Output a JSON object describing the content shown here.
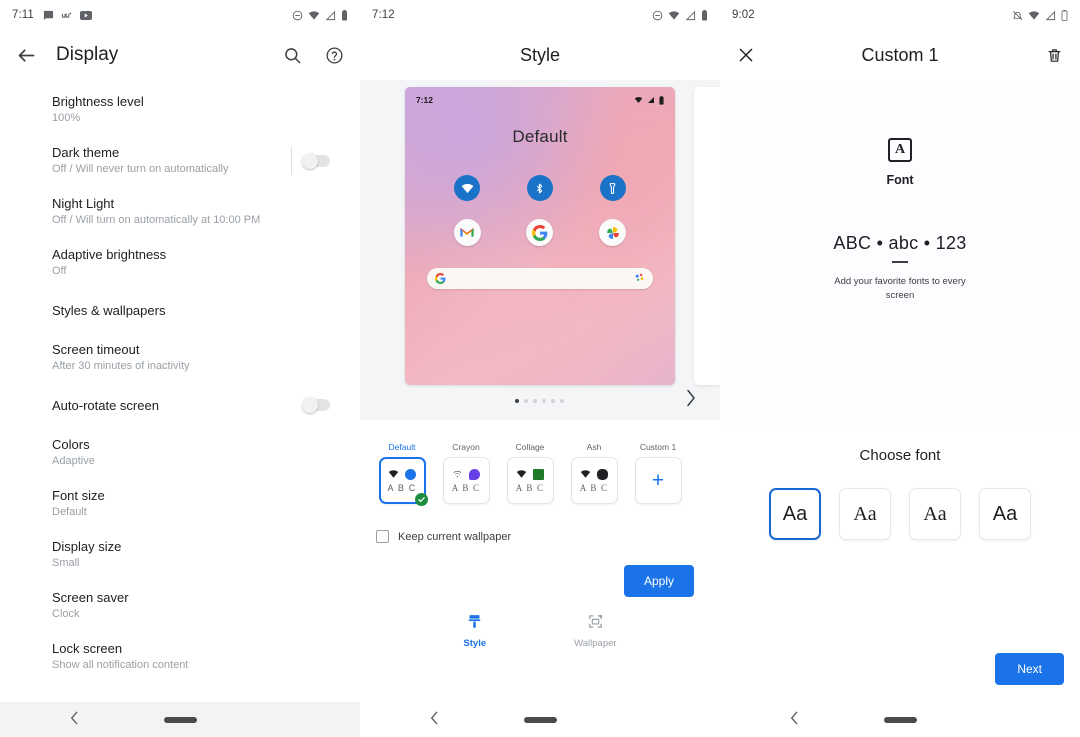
{
  "panels": {
    "display": {
      "status": {
        "time": "7:11",
        "left_icons": [
          "chat-icon",
          "wave-icon",
          "youtube-icon"
        ],
        "right_icons": [
          "dnd-icon",
          "wifi-icon",
          "signal-icon",
          "battery-icon"
        ]
      },
      "appbar": {
        "back": "back-arrow-icon",
        "title": "Display",
        "search": "search-icon",
        "help": "help-icon"
      },
      "items": [
        {
          "title": "Brightness level",
          "subtitle": "100%",
          "toggle": null
        },
        {
          "title": "Dark theme",
          "subtitle": "Off / Will never turn on automatically",
          "toggle": "off"
        },
        {
          "title": "Night Light",
          "subtitle": "Off / Will turn on automatically at 10:00 PM",
          "toggle": null
        },
        {
          "title": "Adaptive brightness",
          "subtitle": "Off",
          "toggle": null
        },
        {
          "title": "Styles & wallpapers",
          "subtitle": "",
          "toggle": null
        },
        {
          "title": "Screen timeout",
          "subtitle": "After 30 minutes of inactivity",
          "toggle": null
        },
        {
          "title": "Auto-rotate screen",
          "subtitle": "",
          "toggle": "off"
        },
        {
          "title": "Colors",
          "subtitle": "Adaptive",
          "toggle": null
        },
        {
          "title": "Font size",
          "subtitle": "Default",
          "toggle": null
        },
        {
          "title": "Display size",
          "subtitle": "Small",
          "toggle": null
        },
        {
          "title": "Screen saver",
          "subtitle": "Clock",
          "toggle": null
        },
        {
          "title": "Lock screen",
          "subtitle": "Show all notification content",
          "toggle": null
        }
      ]
    },
    "style": {
      "status": {
        "time": "7:12",
        "right_icons": [
          "dnd-icon",
          "wifi-icon",
          "signal-icon",
          "battery-icon"
        ]
      },
      "appbar": {
        "title": "Style"
      },
      "preview": {
        "clock": "7:12",
        "label": "Default",
        "quick_tiles": [
          "wifi-icon",
          "bluetooth-icon",
          "flashlight-icon"
        ],
        "apps": [
          "gmail-icon",
          "google-icon",
          "photos-icon"
        ],
        "search_left": "google-g-icon",
        "search_right": "assistant-mic-icon",
        "pages": 6,
        "active_page": 1,
        "next": "chevron-right-icon"
      },
      "thumbs": [
        {
          "label": "Default",
          "abc": "A B C",
          "serif": false,
          "selected": true,
          "shape": "circle",
          "color": "#1a73e8",
          "wifi": "solid"
        },
        {
          "label": "Crayon",
          "abc": "A B C",
          "serif": true,
          "selected": false,
          "shape": "blob",
          "color": "#6b3fe8",
          "wifi": "thin"
        },
        {
          "label": "Collage",
          "abc": "A B C",
          "serif": true,
          "selected": false,
          "shape": "square",
          "color": "#1e7a28",
          "wifi": "solid"
        },
        {
          "label": "Ash",
          "abc": "A B C",
          "serif": true,
          "selected": false,
          "shape": "squircle",
          "color": "#202124",
          "wifi": "solid"
        },
        {
          "label": "Custom 1",
          "abc": "",
          "serif": false,
          "selected": false,
          "shape": "plus",
          "color": "#1a73e8",
          "wifi": ""
        }
      ],
      "keep_wallpaper_label": "Keep current wallpaper",
      "keep_wallpaper_checked": false,
      "apply_label": "Apply",
      "tabs": [
        {
          "label": "Style",
          "icon": "brush-icon",
          "active": true
        },
        {
          "label": "Wallpaper",
          "icon": "wallpaper-icon",
          "active": false
        }
      ]
    },
    "custom": {
      "status": {
        "time": "9:02",
        "right_icons": [
          "notifications-off-icon",
          "wifi-icon",
          "signal-icon",
          "battery-icon"
        ]
      },
      "appbar": {
        "close": "close-icon",
        "title": "Custom 1",
        "delete": "trash-icon"
      },
      "hero": {
        "badge_letter": "A",
        "badge_name": "font-box-icon",
        "section_label": "Font",
        "sample": "ABC • abc • 123",
        "description": "Add your favorite fonts to every screen"
      },
      "choose_title": "Choose font",
      "font_tiles": [
        {
          "sample": "Aa",
          "serif": false,
          "selected": true
        },
        {
          "sample": "Aa",
          "serif": true,
          "selected": false
        },
        {
          "sample": "Aa",
          "serif": true,
          "selected": false
        },
        {
          "sample": "Aa",
          "serif": false,
          "selected": false
        }
      ],
      "next_label": "Next"
    }
  },
  "navbar": {
    "back": "back-chevron-icon",
    "home": "home-pill"
  },
  "colors": {
    "accent": "#1a73e8",
    "accent_dark": "#1967d2",
    "check_green": "#1e8e3e",
    "text_primary": "#202124",
    "text_secondary": "#9aa0a6"
  }
}
